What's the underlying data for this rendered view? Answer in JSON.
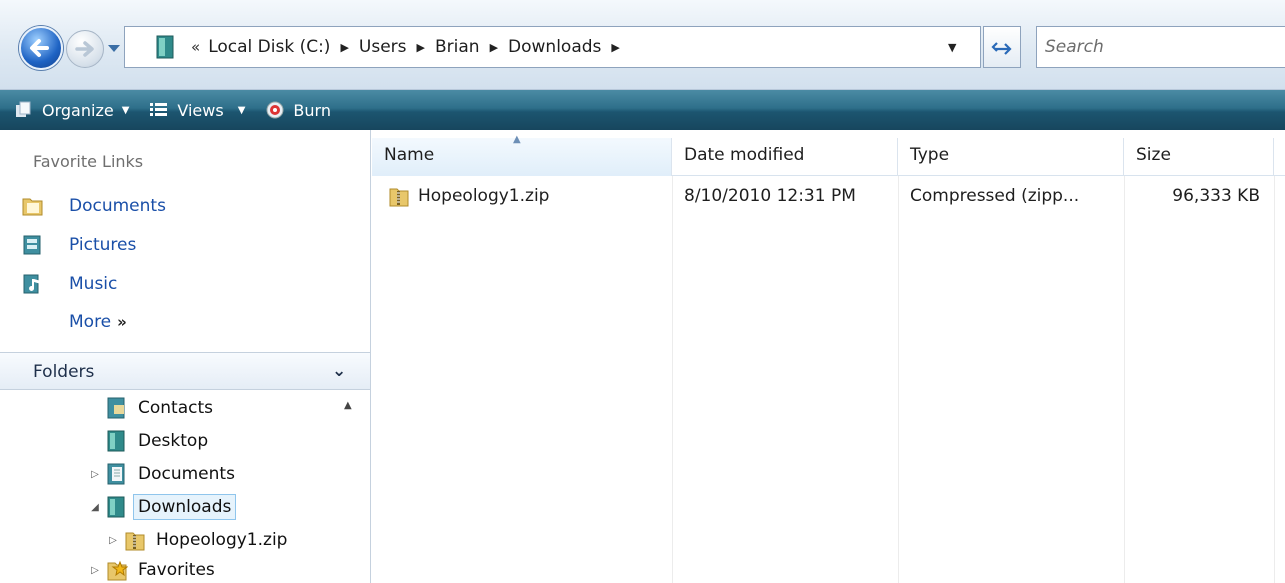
{
  "address": {
    "prefix": "«",
    "path": [
      "Local Disk (C:)",
      "Users",
      "Brian",
      "Downloads"
    ],
    "search_placeholder": "Search"
  },
  "toolbar": {
    "organize": "Organize",
    "views": "Views",
    "burn": "Burn"
  },
  "left_pane": {
    "favorites_header": "Favorite Links",
    "favorites": [
      "Documents",
      "Pictures",
      "Music"
    ],
    "more_label": "More",
    "more_chevron": "»",
    "folders_header": "Folders",
    "tree": [
      {
        "label": "Contacts",
        "expander": "",
        "icon": "contacts-folder-icon"
      },
      {
        "label": "Desktop",
        "expander": "",
        "icon": "desktop-folder-icon"
      },
      {
        "label": "Documents",
        "expander": "▷",
        "icon": "documents-folder-icon"
      },
      {
        "label": "Downloads",
        "expander": "◢",
        "icon": "downloads-folder-icon",
        "selected": true
      },
      {
        "label": "Hopeology1.zip",
        "expander": "▷",
        "icon": "zip-folder-icon"
      },
      {
        "label": "Favorites",
        "expander": "▷",
        "icon": "favorites-folder-icon"
      }
    ]
  },
  "file_list": {
    "columns": [
      "Name",
      "Date modified",
      "Type",
      "Size"
    ],
    "sorted_column": "Name",
    "rows": [
      {
        "name": "Hopeology1.zip",
        "date": "8/10/2010 12:31 PM",
        "type": "Compressed (zipp...",
        "size": "96,333 KB",
        "icon": "zip-folder-icon"
      }
    ]
  },
  "colors": {
    "toolbar_top": "#4b8ba4",
    "toolbar_bottom": "#17465e",
    "link_blue": "#1a4fa8",
    "selection_bg": "#e6f3fc"
  }
}
